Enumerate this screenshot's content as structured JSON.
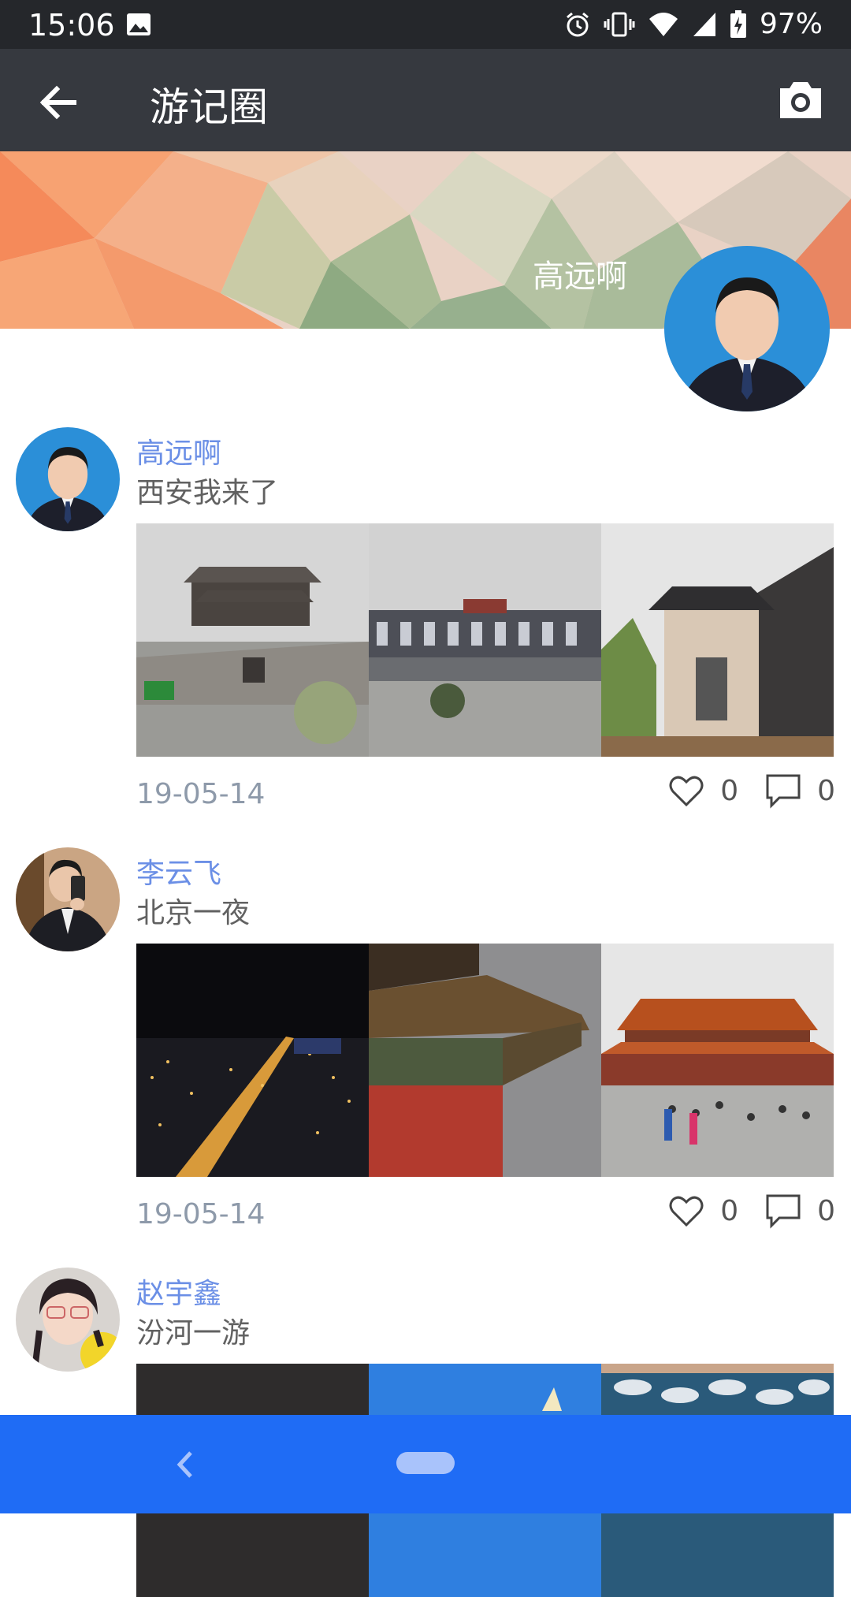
{
  "status_bar": {
    "time": "15:06",
    "battery": "97%",
    "icons": [
      "image-icon",
      "alarm-icon",
      "vibrate-icon",
      "wifi-icon",
      "signal-icon",
      "battery-charging-icon"
    ]
  },
  "app_bar": {
    "title": "游记圈",
    "back_icon": "arrow-left-icon",
    "camera_icon": "camera-icon"
  },
  "profile": {
    "name": "高远啊"
  },
  "posts": [
    {
      "author": "高远啊",
      "text": "西安我来了",
      "date": "19-05-14",
      "likes": "0",
      "comments": "0"
    },
    {
      "author": "李云飞",
      "text": "北京一夜",
      "date": "19-05-14",
      "likes": "0",
      "comments": "0"
    },
    {
      "author": "赵宇鑫",
      "text": "汾河一游"
    }
  ],
  "colors": {
    "status_bar": "#25272b",
    "app_bar": "#36393f",
    "author_name": "#6b8fe6",
    "date": "#8e9aaa",
    "nav_bar": "#1f6cf5"
  }
}
